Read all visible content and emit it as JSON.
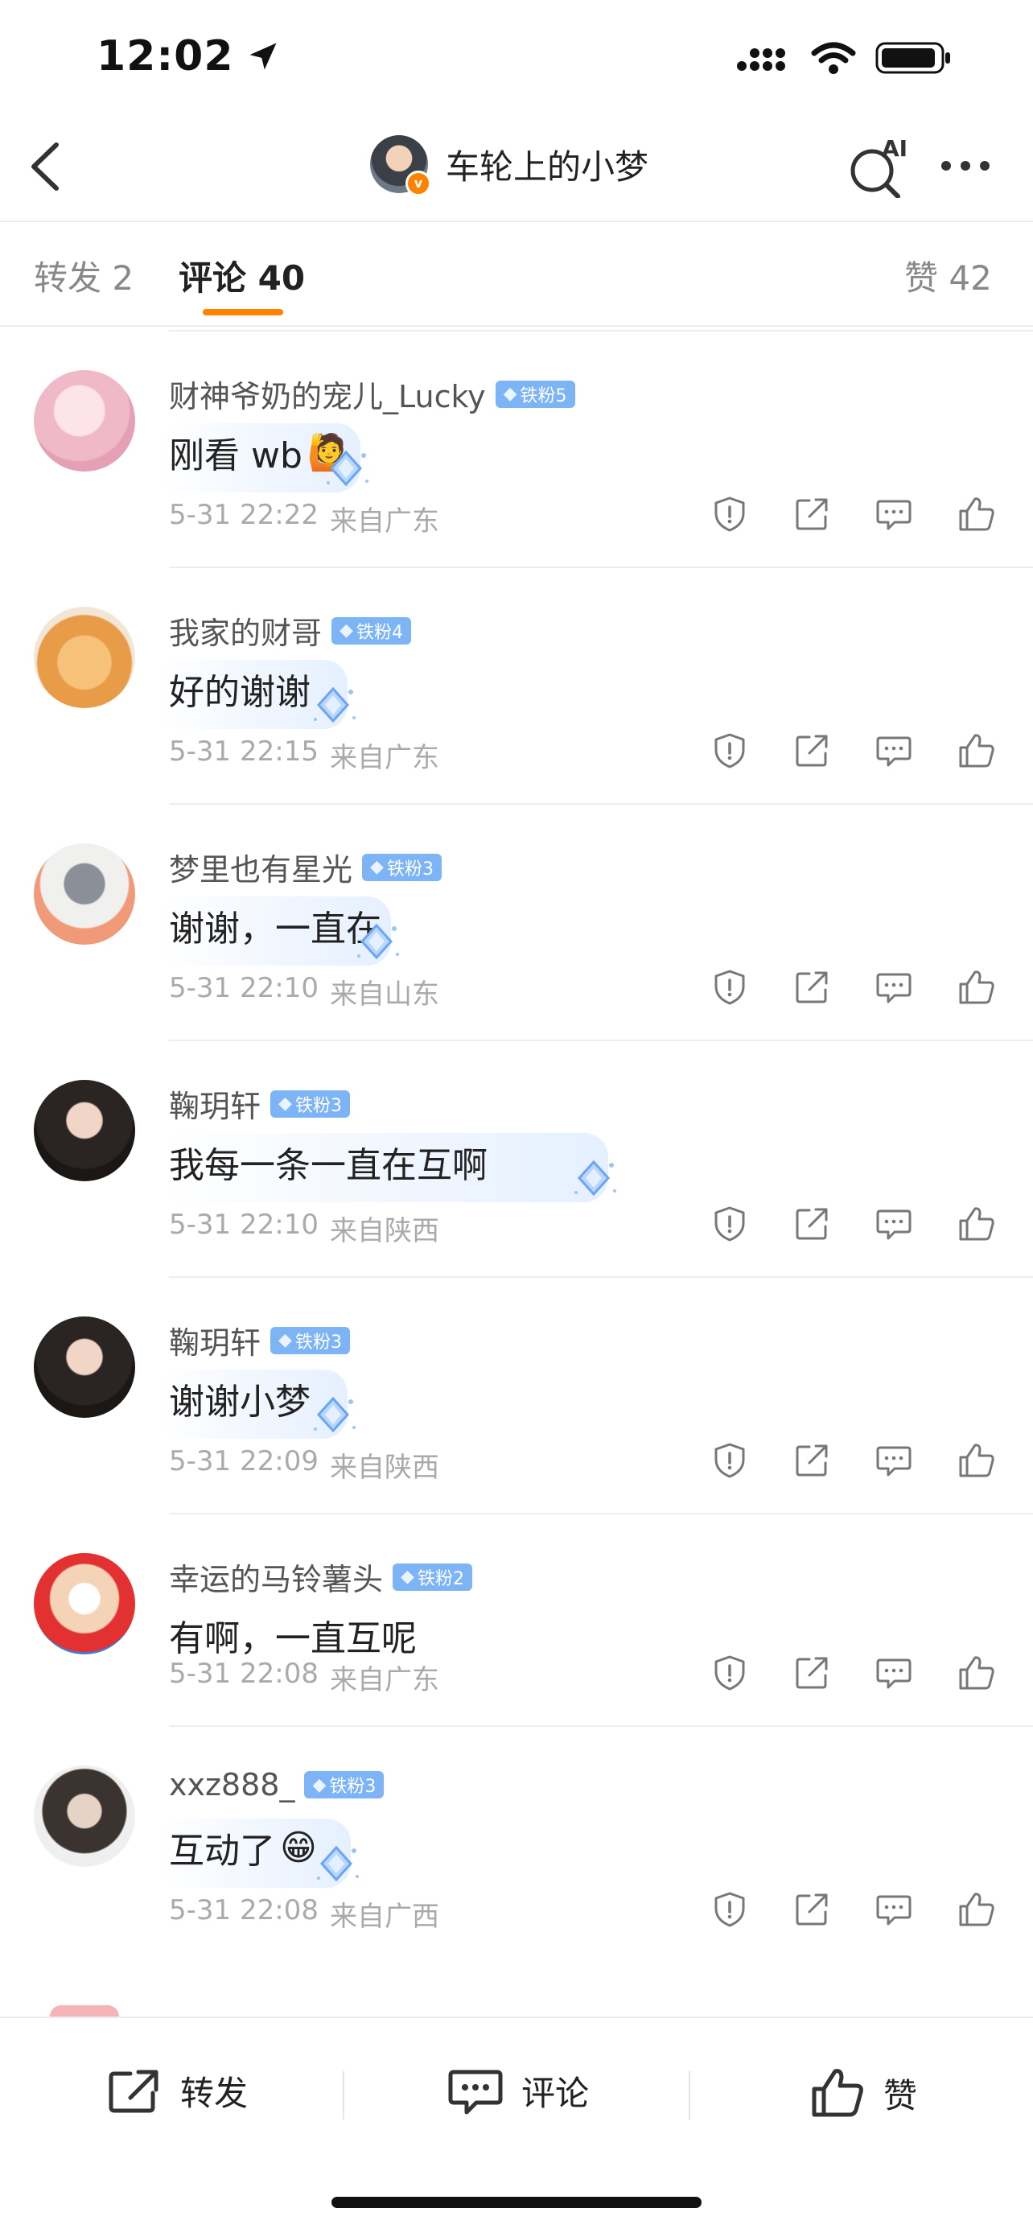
{
  "status": {
    "time": "12:02"
  },
  "nav": {
    "title": "车轮上的小梦",
    "ai_label": "AI"
  },
  "tabs": [
    {
      "label": "转发",
      "count": "2"
    },
    {
      "label": "评论",
      "count": "40"
    },
    {
      "label": "赞",
      "count": "42"
    }
  ],
  "comments": [
    {
      "name": "财神爷奶的宠儿_Lucky",
      "badge": "铁粉5",
      "text": "刚看 wb",
      "emoji": "🙋",
      "time": "5-31 22:22",
      "location": "来自广东"
    },
    {
      "name": "我家的财哥",
      "badge": "铁粉4",
      "text": "好的谢谢",
      "emoji": "",
      "time": "5-31 22:15",
      "location": "来自广东"
    },
    {
      "name": "梦里也有星光",
      "badge": "铁粉3",
      "text": "谢谢，一直在",
      "emoji": "",
      "time": "5-31 22:10",
      "location": "来自山东"
    },
    {
      "name": "鞠玥轩",
      "badge": "铁粉3",
      "text": "我每一条一直在互啊",
      "emoji": "",
      "time": "5-31 22:10",
      "location": "来自陕西"
    },
    {
      "name": "鞠玥轩",
      "badge": "铁粉3",
      "text": "谢谢小梦",
      "emoji": "",
      "time": "5-31 22:09",
      "location": "来自陕西"
    },
    {
      "name": "幸运的马铃薯头",
      "badge": "铁粉2",
      "text": "有啊，一直互呢",
      "emoji": "",
      "time": "5-31 22:08",
      "location": "来自广东"
    },
    {
      "name": "xxz888_",
      "badge": "铁粉3",
      "text": "互动了",
      "emoji": "😁",
      "time": "5-31 22:08",
      "location": "来自广西"
    }
  ],
  "bottom": {
    "repost": "转发",
    "comment": "评论",
    "like": "赞"
  },
  "colors": {
    "accent": "#ff8200",
    "badge": "#7cb4f5"
  }
}
